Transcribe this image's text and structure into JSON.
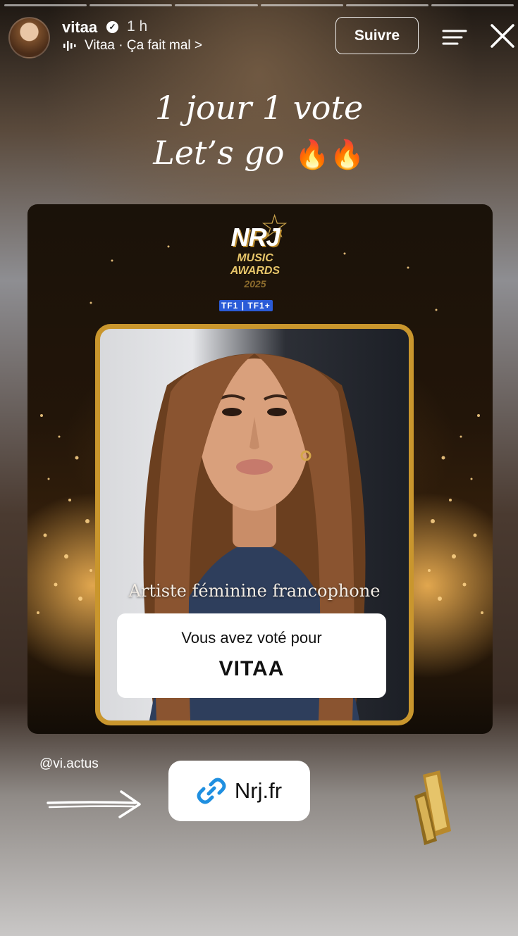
{
  "story": {
    "progress_segments": 6,
    "colors": {
      "accent_gold": "#c9962d",
      "link_blue": "#1f8fe0"
    }
  },
  "header": {
    "username": "vitaa",
    "verified_icon": "verified-badge-icon",
    "time": "1 h",
    "music": "Vitaa · Ça fait mal >",
    "follow_label": "Suivre",
    "menu_icon": "menu-icon",
    "close_icon": "close-icon"
  },
  "caption": {
    "line1": "1 jour 1 vote",
    "line2": "Let’s go",
    "emoji": "🔥🔥"
  },
  "card": {
    "logo": {
      "brand": "NRJ",
      "line1": "MUSIC",
      "line2": "AWARDS",
      "year": "2025"
    },
    "broadcaster": "TF1 | TF1+",
    "category": "Artiste féminine francophone",
    "vote_label": "Vous avez voté pour",
    "vote_name": "VITAA"
  },
  "mention": "@vi.actus",
  "link": {
    "label": "Nrj.fr",
    "icon": "link-icon"
  },
  "sticker_icon": "trophy-icon"
}
